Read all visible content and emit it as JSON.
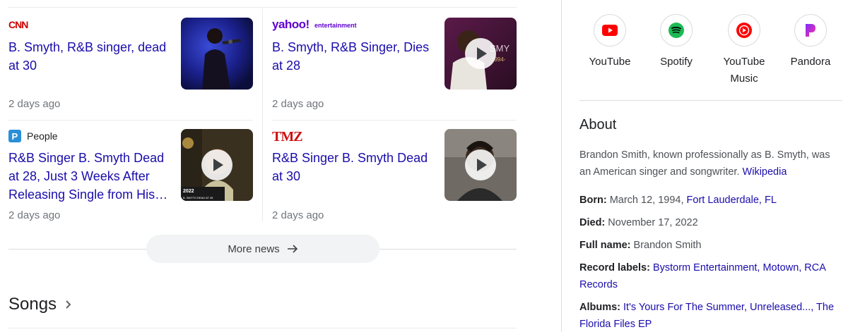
{
  "news": [
    {
      "source": "CNN",
      "source_icon": "cnn-logo",
      "title": "B. Smyth, R&B singer, dead at 30",
      "time": "2 days ago",
      "has_video": false
    },
    {
      "source": "yahoo!entertainment",
      "source_icon": "yahoo-entertainment-logo",
      "title": "B. Smyth, R&B Singer, Dies at 28",
      "time": "2 days ago",
      "has_video": true
    },
    {
      "source": "People",
      "source_icon": "people-logo",
      "title": "R&B Singer B. Smyth Dead at 28, Just 3 Weeks After Releasing Single from His…",
      "time": "2 days ago",
      "has_video": true
    },
    {
      "source": "TMZ",
      "source_icon": "tmz-logo",
      "title": "R&B Singer B. Smyth Dead at 30",
      "time": "2 days ago",
      "has_video": true
    }
  ],
  "more_news": "More news",
  "songs_heading": "Songs",
  "listen": [
    {
      "name": "YouTube",
      "icon": "youtube-icon",
      "color": "#ff0000"
    },
    {
      "name": "Spotify",
      "icon": "spotify-icon",
      "color": "#1db954"
    },
    {
      "name": "YouTube Music",
      "icon": "youtube-music-icon",
      "color": "#ff0000"
    },
    {
      "name": "Pandora",
      "icon": "pandora-icon",
      "color": "#c400ff"
    }
  ],
  "about": {
    "heading": "About",
    "description": "Brandon Smith, known professionally as B. Smyth, was an American singer and songwriter.",
    "source_link": "Wikipedia",
    "born_label": "Born:",
    "born_value": "March 12, 1994,",
    "born_place": "Fort Lauderdale, FL",
    "died_label": "Died:",
    "died_value": "November 17, 2022",
    "fullname_label": "Full name:",
    "fullname_value": "Brandon Smith",
    "labels_label": "Record labels:",
    "labels_value": "Bystorm Entertainment, Motown, RCA Records",
    "albums_label": "Albums:",
    "albums_value": "It's Yours For The Summer, Unreleased..., The Florida Files EP"
  },
  "thumb_caption": "2022",
  "thumb_subcaption": "B. SMYTH DEAD AT 28",
  "thumb_overlay_text": "SMY",
  "thumb_overlay_sub": "1994-"
}
